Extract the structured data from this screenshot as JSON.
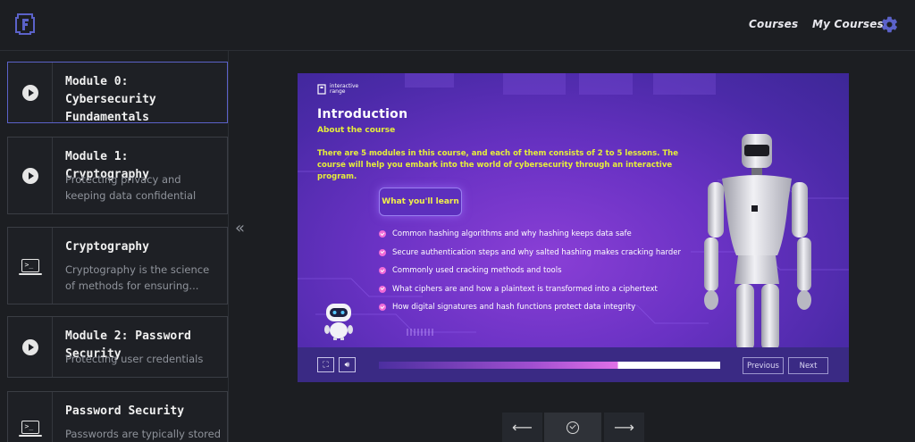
{
  "header": {
    "logo_icon": "app-logo-icon",
    "nav": [
      {
        "label": "Courses"
      },
      {
        "label": "My Courses"
      }
    ],
    "settings_icon": "gear-icon"
  },
  "sidebar": {
    "items": [
      {
        "title": "Module 0: Cybersecurity Fundamentals",
        "description": "",
        "icon": "play-icon",
        "active": true
      },
      {
        "title": "Module 1: Cryptography",
        "description": "Protecting privacy and keeping data confidential",
        "icon": "play-icon",
        "active": false
      },
      {
        "title": "Cryptography",
        "description": "Cryptography is the science of methods for ensuring...",
        "icon": "terminal-icon",
        "active": false
      },
      {
        "title": "Module 2: Password Security",
        "description": "Protecting user credentials",
        "icon": "play-icon",
        "active": false
      },
      {
        "title": "Password Security",
        "description": "Passwords are typically stored",
        "icon": "terminal-icon",
        "active": false
      }
    ],
    "collapse_icon": "double-chevron-left-icon"
  },
  "slide": {
    "brand": "interactive range",
    "title": "Introduction",
    "subtitle": "About the course",
    "paragraph": "There are 5 modules in this course, and each of them consists of 2 to 5 lessons. The course will help you embark into the world of cybersecurity through an interactive program.",
    "learn_label": "What you'll learn",
    "bullets": [
      "Common hashing algorithms and why hashing keeps data safe",
      "Secure authentication steps and why salted hashing makes cracking harder",
      "Commonly used cracking methods and tools",
      "What ciphers are and how a plaintext is transformed into a ciphertext",
      "How digital signatures and hash functions protect data integrity"
    ],
    "progress": 0.7,
    "previous_label": "Previous",
    "next_label": "Next"
  },
  "bottom_nav": {
    "prev_icon": "arrow-left-icon",
    "complete_icon": "check-circle-icon",
    "next_icon": "arrow-right-icon"
  },
  "colors": {
    "background": "#1c1e22",
    "accent": "#5b62c9",
    "slide_purple": "#6a32c4",
    "highlight_yellow": "#e6ee3a",
    "bullet_pink": "#f06bd8"
  }
}
